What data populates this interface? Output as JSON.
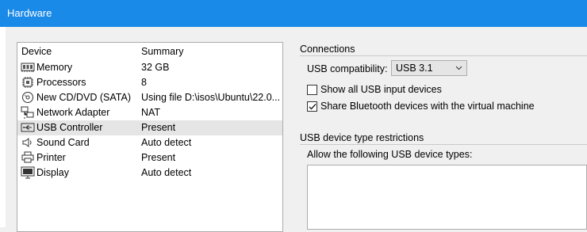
{
  "window": {
    "title": "Hardware"
  },
  "devices": {
    "header_device": "Device",
    "header_summary": "Summary",
    "items": [
      {
        "name": "Memory",
        "summary": "32 GB",
        "icon": "memory-icon"
      },
      {
        "name": "Processors",
        "summary": "8",
        "icon": "processor-icon"
      },
      {
        "name": "New CD/DVD (SATA)",
        "summary": "Using file D:\\isos\\Ubuntu\\22.0...",
        "icon": "cd-dvd-icon"
      },
      {
        "name": "Network Adapter",
        "summary": "NAT",
        "icon": "network-adapter-icon"
      },
      {
        "name": "USB Controller",
        "summary": "Present",
        "icon": "usb-controller-icon"
      },
      {
        "name": "Sound Card",
        "summary": "Auto detect",
        "icon": "speaker-icon"
      },
      {
        "name": "Printer",
        "summary": "Present",
        "icon": "printer-icon"
      },
      {
        "name": "Display",
        "summary": "Auto detect",
        "icon": "display-icon"
      }
    ]
  },
  "connections": {
    "title": "Connections",
    "usb_compat_label": "USB compatibility:",
    "usb_compat_value": "USB 3.1",
    "show_all_label": "Show all USB input devices",
    "show_all_checked": false,
    "share_bt_label": "Share Bluetooth devices with the virtual machine",
    "share_bt_checked": true
  },
  "restrictions": {
    "title": "USB device type restrictions",
    "allow_label": "Allow the following USB device types:"
  },
  "colors": {
    "titlebar": "#1a8ae8",
    "selected_row": "#e5e5e5"
  }
}
